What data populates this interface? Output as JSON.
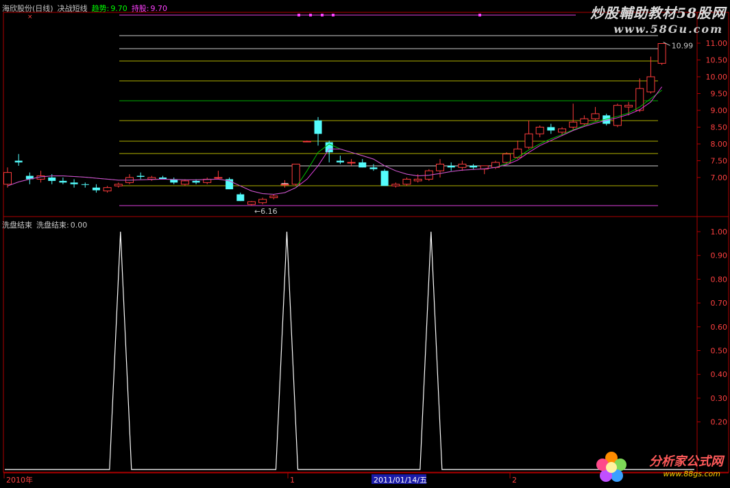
{
  "top_header": {
    "title": "海欣股份(日线)",
    "indicator": "决战短线",
    "trend_label": "趋势:",
    "trend_value": "9.70",
    "hold_label": "持股:",
    "hold_value": "9.70"
  },
  "bottom_header": {
    "indicator": "洗盘结束",
    "series_label": "洗盘结束:",
    "series_value": "0.00"
  },
  "watermark": {
    "line1": "炒股輔助教材58股网",
    "line2": "www.58Gu.com",
    "bottom_logo": "分析家公式网",
    "bottom_url": "www.88gs.com"
  },
  "x_axis": {
    "year_label": "2010年",
    "month_label_1": "1",
    "cursor_date": "2011/01/14/五",
    "month_label_2": "2"
  },
  "colors": {
    "up": "#ff3c3c",
    "down": "#54fcfc",
    "trend_line": "#00c000",
    "hold_line": "#e040e0",
    "frame": "#b00000",
    "hline": "#b0b000",
    "spike": "#ffffff",
    "axis_text": "#ff4040",
    "header_trend": "#00ff00",
    "header_hold": "#ff40ff"
  },
  "chart_data": [
    {
      "type": "candlestick",
      "title": "海欣股份(日线)",
      "y_ticks": [
        "11.00",
        "10.50",
        "10.00",
        "9.50",
        "9.00",
        "8.50",
        "8.00",
        "7.50",
        "7.00"
      ],
      "ylim": [
        6.0,
        11.1
      ],
      "annotations": [
        {
          "label": "←6.16",
          "bar": 22,
          "value": 6.16
        },
        {
          "label": "10.99",
          "bar": 59,
          "value": 10.99
        }
      ],
      "ohlc": [
        [
          6.8,
          7.3,
          6.7,
          7.15
        ],
        [
          7.5,
          7.7,
          7.35,
          7.45
        ],
        [
          7.05,
          7.15,
          6.8,
          6.95
        ],
        [
          6.95,
          7.2,
          6.85,
          7.05
        ],
        [
          7.0,
          7.1,
          6.8,
          6.9
        ],
        [
          6.9,
          7.0,
          6.8,
          6.85
        ],
        [
          6.85,
          6.95,
          6.7,
          6.8
        ],
        [
          6.8,
          6.85,
          6.7,
          6.78
        ],
        [
          6.7,
          6.8,
          6.55,
          6.62
        ],
        [
          6.6,
          6.75,
          6.55,
          6.7
        ],
        [
          6.75,
          6.85,
          6.7,
          6.8
        ],
        [
          6.85,
          7.1,
          6.8,
          7.0
        ],
        [
          7.05,
          7.15,
          6.95,
          7.02
        ],
        [
          6.95,
          7.05,
          6.9,
          7.0
        ],
        [
          7.0,
          7.05,
          6.95,
          6.95
        ],
        [
          6.95,
          7.0,
          6.8,
          6.85
        ],
        [
          6.8,
          6.95,
          6.75,
          6.9
        ],
        [
          6.9,
          6.95,
          6.8,
          6.85
        ],
        [
          6.85,
          7.0,
          6.8,
          6.95
        ],
        [
          7.0,
          7.2,
          6.95,
          7.0
        ],
        [
          6.95,
          7.0,
          6.7,
          6.65
        ],
        [
          6.5,
          6.55,
          6.3,
          6.3
        ],
        [
          6.2,
          6.3,
          6.16,
          6.28
        ],
        [
          6.25,
          6.4,
          6.2,
          6.35
        ],
        [
          6.4,
          6.5,
          6.35,
          6.45
        ],
        [
          6.8,
          6.92,
          6.7,
          6.8
        ],
        [
          6.8,
          7.4,
          6.75,
          7.4
        ],
        [
          8.08,
          8.1,
          8.07,
          8.08
        ],
        [
          8.7,
          8.8,
          7.95,
          8.3
        ],
        [
          8.05,
          8.1,
          7.45,
          7.75
        ],
        [
          7.5,
          7.65,
          7.4,
          7.45
        ],
        [
          7.45,
          7.55,
          7.35,
          7.45
        ],
        [
          7.45,
          7.55,
          7.3,
          7.3
        ],
        [
          7.3,
          7.4,
          7.2,
          7.25
        ],
        [
          7.2,
          7.25,
          6.75,
          6.75
        ],
        [
          6.75,
          6.85,
          6.7,
          6.8
        ],
        [
          6.8,
          7.0,
          6.75,
          6.95
        ],
        [
          6.9,
          7.1,
          6.85,
          6.95
        ],
        [
          6.95,
          7.25,
          6.9,
          7.2
        ],
        [
          7.2,
          7.55,
          7.0,
          7.4
        ],
        [
          7.35,
          7.45,
          7.2,
          7.3
        ],
        [
          7.3,
          7.5,
          7.2,
          7.4
        ],
        [
          7.35,
          7.4,
          7.25,
          7.3
        ],
        [
          7.25,
          7.35,
          7.1,
          7.35
        ],
        [
          7.3,
          7.5,
          7.25,
          7.45
        ],
        [
          7.45,
          7.75,
          7.4,
          7.7
        ],
        [
          7.6,
          8.1,
          7.55,
          7.85
        ],
        [
          7.9,
          8.7,
          7.85,
          8.3
        ],
        [
          8.3,
          8.55,
          8.2,
          8.5
        ],
        [
          8.5,
          8.6,
          8.3,
          8.4
        ],
        [
          8.35,
          8.5,
          8.25,
          8.45
        ],
        [
          8.5,
          9.2,
          8.4,
          8.65
        ],
        [
          8.6,
          8.85,
          8.55,
          8.75
        ],
        [
          8.75,
          9.1,
          8.7,
          8.9
        ],
        [
          8.85,
          8.9,
          8.55,
          8.6
        ],
        [
          8.55,
          9.2,
          8.5,
          9.15
        ],
        [
          9.1,
          9.25,
          8.85,
          9.15
        ],
        [
          9.0,
          9.95,
          8.95,
          9.65
        ],
        [
          9.55,
          10.6,
          9.5,
          10.0
        ],
        [
          10.4,
          10.99,
          10.35,
          10.99
        ]
      ],
      "series": [
        {
          "name": "趋势",
          "values": [
            6.75,
            6.87,
            6.95,
            7.02,
            7.05,
            7.05,
            7.03,
            7.01,
            6.98,
            6.95,
            6.92,
            6.92,
            6.93,
            6.94,
            6.95,
            6.94,
            6.93,
            6.93,
            6.94,
            6.95,
            6.9,
            6.75,
            6.6,
            6.52,
            6.5,
            6.55,
            6.7,
            7.2,
            7.75,
            8.0,
            7.85,
            7.75,
            7.65,
            7.55,
            7.35,
            7.2,
            7.1,
            7.05,
            7.07,
            7.12,
            7.18,
            7.22,
            7.24,
            7.26,
            7.3,
            7.42,
            7.6,
            7.82,
            8.0,
            8.15,
            8.28,
            8.42,
            8.55,
            8.66,
            8.74,
            8.82,
            8.92,
            9.1,
            9.35,
            9.6
          ]
        },
        {
          "name": "持股",
          "values": [
            6.75,
            6.87,
            6.95,
            7.02,
            7.05,
            7.05,
            7.03,
            7.01,
            6.98,
            6.95,
            6.92,
            6.92,
            6.93,
            6.94,
            6.95,
            6.94,
            6.93,
            6.93,
            6.94,
            6.95,
            6.9,
            6.75,
            6.6,
            6.52,
            6.5,
            6.55,
            6.7,
            6.95,
            7.35,
            7.85,
            7.85,
            7.75,
            7.65,
            7.55,
            7.35,
            7.2,
            7.1,
            7.05,
            7.07,
            7.12,
            7.18,
            7.22,
            7.24,
            7.26,
            7.3,
            7.38,
            7.52,
            7.75,
            7.95,
            8.1,
            8.25,
            8.4,
            8.52,
            8.62,
            8.7,
            8.78,
            8.88,
            9.02,
            9.25,
            9.7
          ]
        }
      ]
    },
    {
      "type": "line",
      "title": "洗盘结束",
      "series_name": "洗盘结束",
      "y_ticks": [
        "1.00",
        "0.90",
        "0.80",
        "0.70",
        "0.60",
        "0.50",
        "0.40",
        "0.30",
        "0.20"
      ],
      "ylim": [
        0,
        1.0
      ],
      "spikes_at_bars": [
        10,
        25,
        38
      ],
      "values": [
        0,
        0,
        0,
        0,
        0,
        0,
        0,
        0,
        0,
        0,
        1,
        0,
        0,
        0,
        0,
        0,
        0,
        0,
        0,
        0,
        0,
        0,
        0,
        0,
        0,
        1,
        0,
        0,
        0,
        0,
        0,
        0,
        0,
        0,
        0,
        0,
        0,
        0,
        1,
        0,
        0,
        0,
        0,
        0,
        0,
        0,
        0,
        0,
        0,
        0,
        0,
        0,
        0,
        0,
        0,
        0,
        0,
        0,
        0,
        0
      ]
    }
  ]
}
